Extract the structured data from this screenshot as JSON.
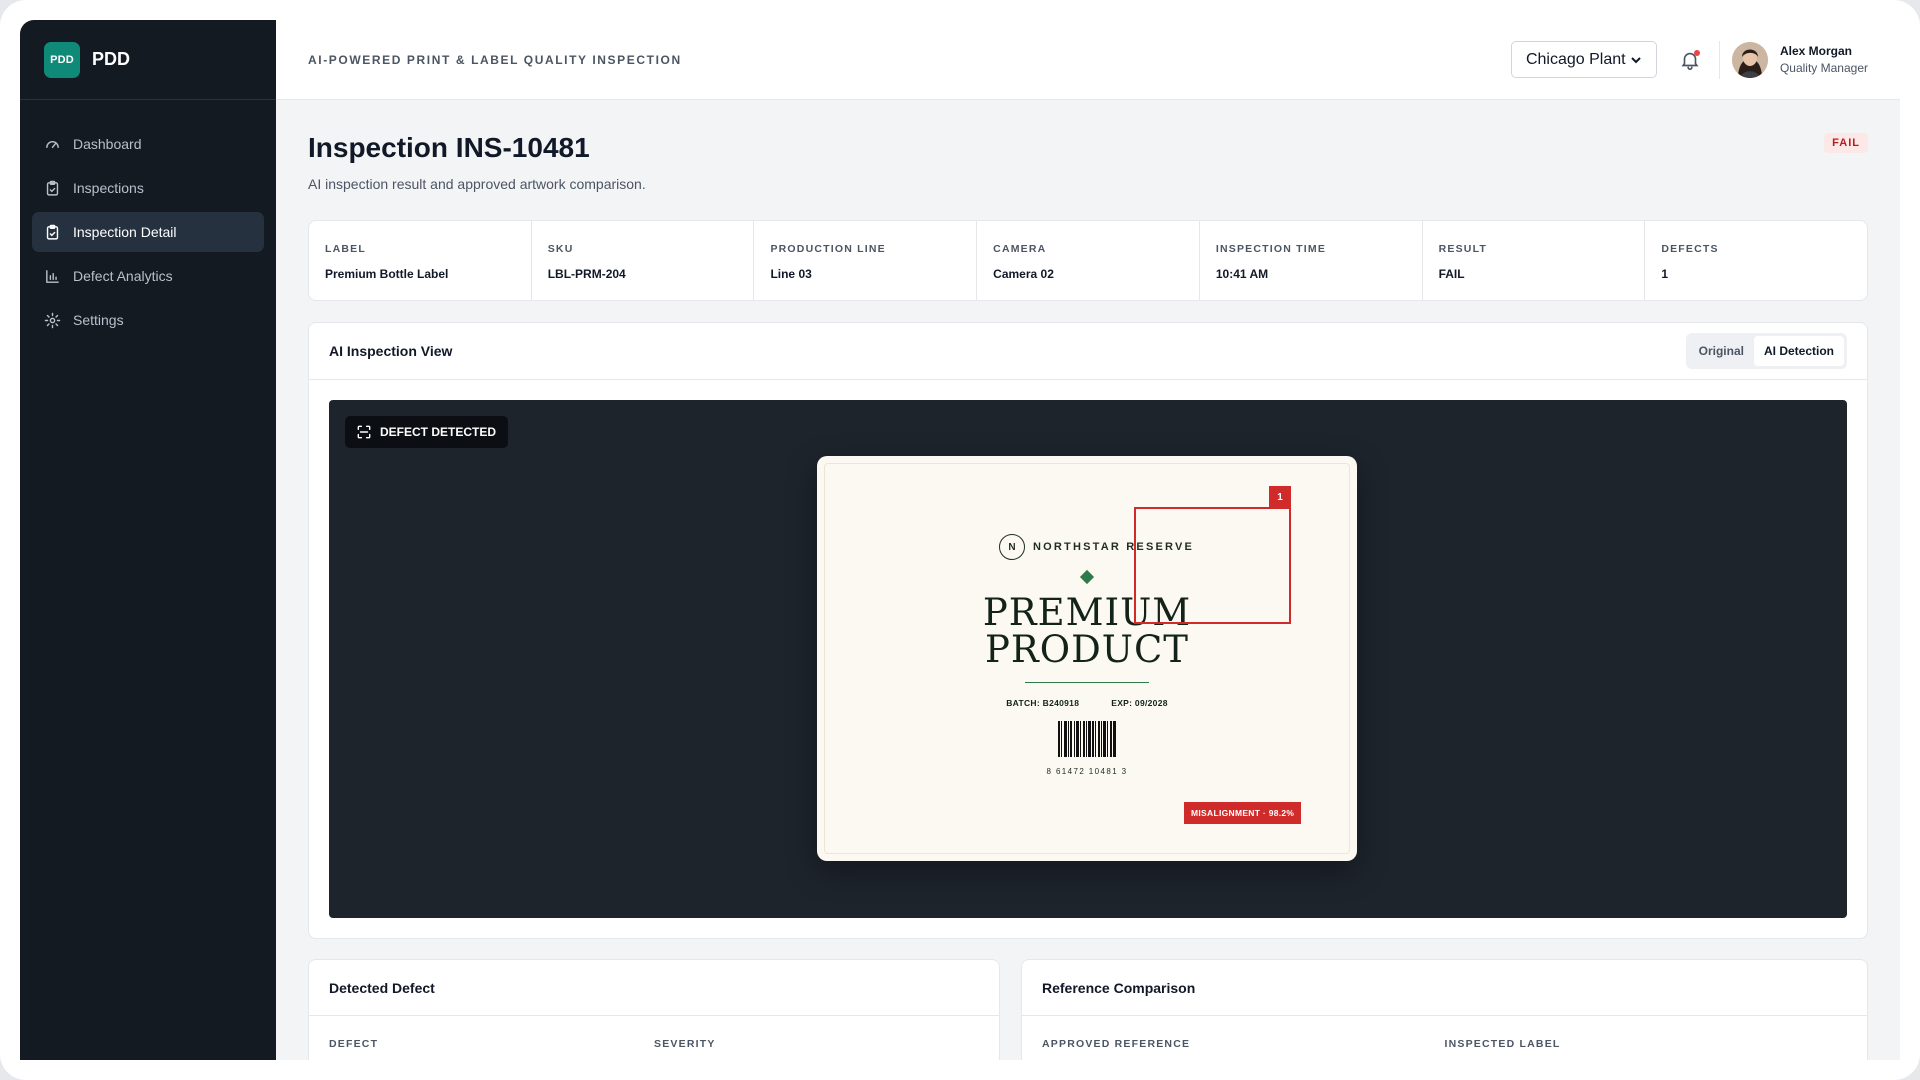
{
  "app": {
    "logo": "PDD",
    "name": "PDD"
  },
  "sidebar": {
    "items": [
      {
        "label": "Dashboard",
        "icon": "gauge-icon"
      },
      {
        "label": "Inspections",
        "icon": "clipboard-icon"
      },
      {
        "label": "Inspection Detail",
        "icon": "clipboard-check-icon",
        "active": true
      },
      {
        "label": "Defect Analytics",
        "icon": "bar-chart-icon"
      },
      {
        "label": "Settings",
        "icon": "gear-icon"
      }
    ]
  },
  "topbar": {
    "tagline": "AI-POWERED PRINT & LABEL QUALITY INSPECTION",
    "plant": "Chicago Plant",
    "user": {
      "name": "Alex Morgan",
      "role": "Quality Manager"
    }
  },
  "page": {
    "title": "Inspection INS-10481",
    "subtitle": "AI inspection result and approved artwork comparison.",
    "status": "FAIL"
  },
  "meta": [
    {
      "label": "LABEL",
      "value": "Premium Bottle Label"
    },
    {
      "label": "SKU",
      "value": "LBL-PRM-204"
    },
    {
      "label": "PRODUCTION LINE",
      "value": "Line 03"
    },
    {
      "label": "CAMERA",
      "value": "Camera 02"
    },
    {
      "label": "INSPECTION TIME",
      "value": "10:41 AM"
    },
    {
      "label": "RESULT",
      "value": "FAIL"
    },
    {
      "label": "DEFECTS",
      "value": "1"
    }
  ],
  "view": {
    "title": "AI Inspection View",
    "tabs": [
      "Original",
      "AI Detection"
    ],
    "active_tab": "AI Detection",
    "badge": "DEFECT DETECTED"
  },
  "label": {
    "brand_mark": "N",
    "brand": "NORTHSTAR RESERVE",
    "title_line1": "PREMIUM",
    "title_line2": "PRODUCT",
    "batch": "BATCH: B240918",
    "exp": "EXP: 09/2028",
    "barcode_number": "8 61472 10481 3",
    "detection_index": "1",
    "detection_tag": "MISALIGNMENT · 98.2%"
  },
  "defect_card": {
    "title": "Detected Defect",
    "columns": [
      "DEFECT",
      "SEVERITY"
    ]
  },
  "reference_card": {
    "title": "Reference Comparison",
    "columns": [
      "APPROVED REFERENCE",
      "INSPECTED LABEL"
    ]
  },
  "colors": {
    "accent": "#0f8a78",
    "fail": "#cf2b2b",
    "sidebar": "#141a22"
  }
}
